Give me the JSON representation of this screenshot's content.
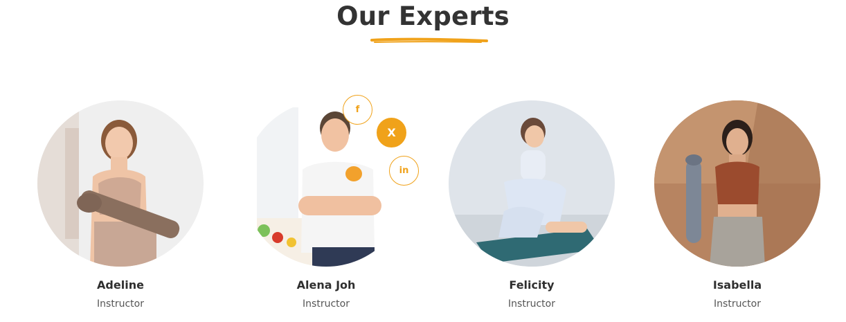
{
  "section": {
    "title": "Our Experts",
    "accent": "#f0a21a"
  },
  "experts": [
    {
      "name": "Adeline",
      "role": "Instructor"
    },
    {
      "name": "Alena Joh",
      "role": "Instructor"
    },
    {
      "name": "Felicity",
      "role": "Instructor"
    },
    {
      "name": "Isabella",
      "role": "Instructor"
    }
  ],
  "social": {
    "facebook": {
      "icon": "facebook-icon",
      "glyph": "f"
    },
    "x": {
      "icon": "x-twitter-icon",
      "glyph": "X"
    },
    "linkedin": {
      "icon": "linkedin-icon",
      "glyph": "in"
    }
  }
}
